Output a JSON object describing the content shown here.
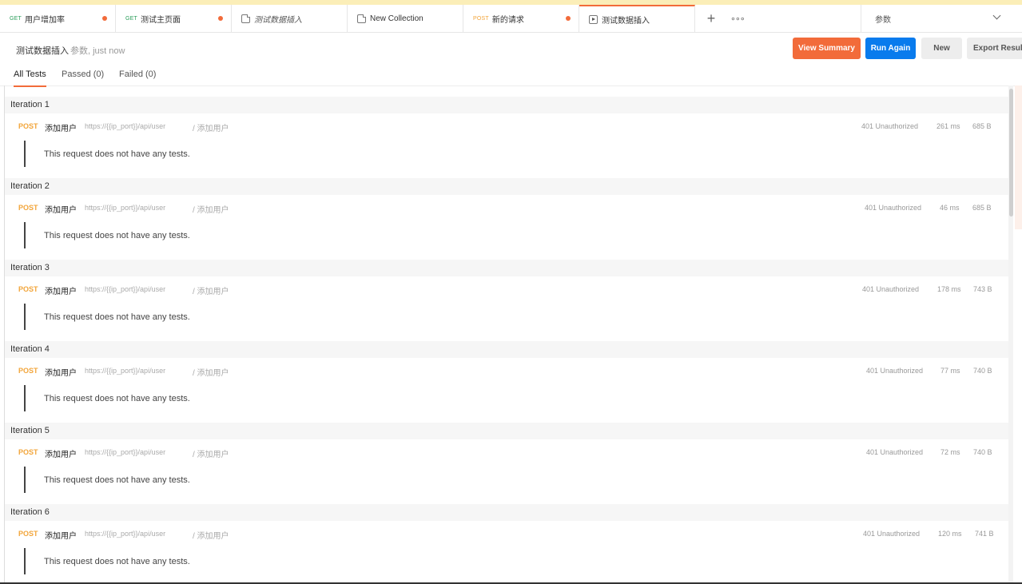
{
  "tabs": [
    {
      "method": "GET",
      "label": "用户增加率",
      "unsaved": true
    },
    {
      "method": "GET",
      "label": "测试主页面",
      "unsaved": true
    },
    {
      "icon": "collection-icon",
      "label": "测试数据插入",
      "italic": true
    },
    {
      "icon": "collection-icon",
      "label": "New Collection"
    },
    {
      "method": "POST",
      "label": "新的请求",
      "unsaved": true
    },
    {
      "icon": "runner-play-icon",
      "label": "测试数据插入",
      "active": true
    }
  ],
  "environment": {
    "selected": "参数"
  },
  "header": {
    "title": "测试数据插入",
    "meta": "参数, just now",
    "view_summary_label": "View Summary",
    "run_again_label": "Run Again",
    "new_label": "New",
    "export_label": "Export Results"
  },
  "subtabs": [
    "All Tests",
    "Passed (0)",
    "Failed (0)"
  ],
  "iterations": [
    {
      "label": "Iteration 1",
      "method": "POST",
      "name": "添加用户",
      "url": "https://{{ip_port}}/api/user",
      "path": "/ 添加用户",
      "status": "401 Unauthorized",
      "time": "261 ms",
      "size": "685 B",
      "tests_text": "This request does not have any tests."
    },
    {
      "label": "Iteration 2",
      "method": "POST",
      "name": "添加用户",
      "url": "https://{{ip_port}}/api/user",
      "path": "/ 添加用户",
      "status": "401 Unauthorized",
      "time": "46 ms",
      "size": "685 B",
      "tests_text": "This request does not have any tests."
    },
    {
      "label": "Iteration 3",
      "method": "POST",
      "name": "添加用户",
      "url": "https://{{ip_port}}/api/user",
      "path": "/ 添加用户",
      "status": "401 Unauthorized",
      "time": "178 ms",
      "size": "743 B",
      "tests_text": "This request does not have any tests."
    },
    {
      "label": "Iteration 4",
      "method": "POST",
      "name": "添加用户",
      "url": "https://{{ip_port}}/api/user",
      "path": "/ 添加用户",
      "status": "401 Unauthorized",
      "time": "77 ms",
      "size": "740 B",
      "tests_text": "This request does not have any tests."
    },
    {
      "label": "Iteration 5",
      "method": "POST",
      "name": "添加用户",
      "url": "https://{{ip_port}}/api/user",
      "path": "/ 添加用户",
      "status": "401 Unauthorized",
      "time": "72 ms",
      "size": "740 B",
      "tests_text": "This request does not have any tests."
    },
    {
      "label": "Iteration 6",
      "method": "POST",
      "name": "添加用户",
      "url": "https://{{ip_port}}/api/user",
      "path": "/ 添加用户",
      "status": "401 Unauthorized",
      "time": "120 ms",
      "size": "741 B",
      "tests_text": "This request does not have any tests."
    }
  ],
  "colors": {
    "accent": "#f26b3a",
    "primary": "#097bed",
    "post_method": "#f2a53a",
    "get_method": "#2a9d5a"
  }
}
